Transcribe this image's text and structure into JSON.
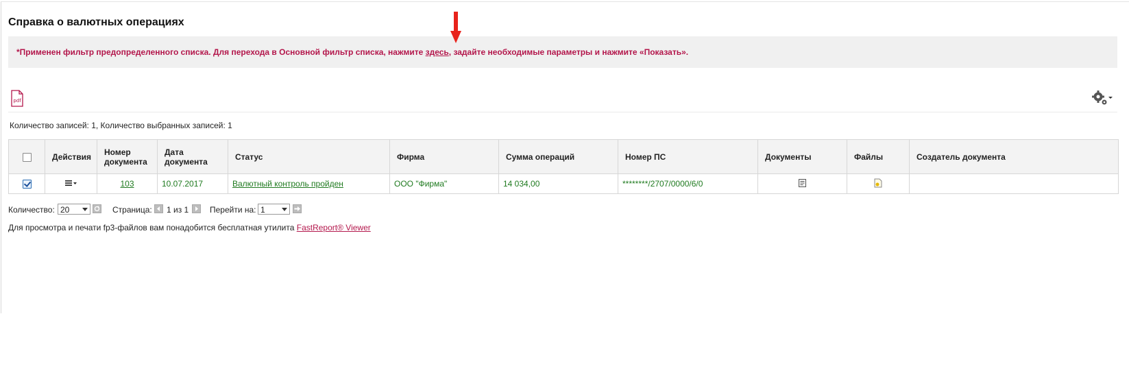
{
  "page": {
    "title": "Справка о валютных операциях"
  },
  "notice": {
    "prefix": "*Применен фильтр предопределенного списка. Для перехода в Основной фильтр списка, нажмите ",
    "link": "здесь",
    "suffix": ", задайте необходимые параметры и нажмите «Показать»."
  },
  "toolbar": {
    "pdf_icon_text": "pdf",
    "icons": [
      "pdf-icon",
      "gear-icon"
    ]
  },
  "records": {
    "summary": "Количество записей: 1, Количество выбранных записей: 1"
  },
  "table": {
    "columns": {
      "actions": "Действия",
      "doc_number": "Номер документа",
      "doc_date": "Дата документа",
      "status": "Статус",
      "firm": "Фирма",
      "amount": "Сумма операций",
      "ps_number": "Номер ПС",
      "documents": "Документы",
      "files": "Файлы",
      "creator": "Создатель документа"
    },
    "rows": [
      {
        "checked": true,
        "doc_number": "103",
        "doc_date": "10.07.2017",
        "status": "Валютный контроль пройден",
        "firm": "ООО \"Фирма\"",
        "amount": "14 034,00",
        "ps_number": "********/2707/0000/6/0",
        "creator": ""
      }
    ]
  },
  "pager": {
    "count_label": "Количество:",
    "count_value": "20",
    "page_label": "Страница:",
    "page_info": "1 из 1",
    "goto_label": "Перейти на:",
    "goto_value": "1"
  },
  "footer": {
    "text": "Для просмотра и печати fp3-файлов вам понадобится бесплатная утилита ",
    "link": "FastReport® Viewer"
  },
  "colors": {
    "accent": "#b3164b",
    "green": "#1f7a1f",
    "arrow": "#e8231c"
  }
}
